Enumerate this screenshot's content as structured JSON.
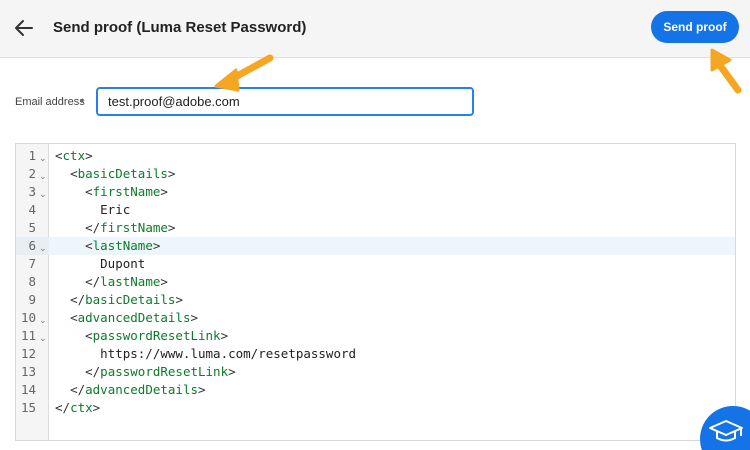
{
  "header": {
    "back_icon": "arrow-left-icon",
    "title": "Send proof (Luma Reset Password)",
    "send_button": "Send proof"
  },
  "form": {
    "email_label": "Email address",
    "required_marker": "*",
    "email_value": "test.proof@adobe.com"
  },
  "editor": {
    "active_line": 6,
    "lines": [
      {
        "n": "1",
        "fold": true
      },
      {
        "n": "2",
        "fold": true
      },
      {
        "n": "3",
        "fold": true
      },
      {
        "n": "4",
        "fold": false
      },
      {
        "n": "5",
        "fold": false
      },
      {
        "n": "6",
        "fold": true
      },
      {
        "n": "7",
        "fold": false
      },
      {
        "n": "8",
        "fold": false
      },
      {
        "n": "9",
        "fold": false
      },
      {
        "n": "10",
        "fold": true
      },
      {
        "n": "11",
        "fold": true
      },
      {
        "n": "12",
        "fold": false
      },
      {
        "n": "13",
        "fold": false
      },
      {
        "n": "14",
        "fold": false
      },
      {
        "n": "15",
        "fold": false
      }
    ],
    "code": [
      "<ctx>",
      "  <basicDetails>",
      "    <firstName>",
      "      Eric",
      "    </firstName>",
      "    <lastName>",
      "      Dupont",
      "    </lastName>",
      "  </basicDetails>",
      "  <advancedDetails>",
      "    <passwordResetLink>",
      "      https://www.luma.com/resetpassword",
      "    </passwordResetLink>",
      "  </advancedDetails>",
      "</ctx>"
    ]
  },
  "overlays": {
    "arrow_color": "#f5a623",
    "fab_icon": "graduation-cap-icon",
    "accent": "#1473e6"
  }
}
